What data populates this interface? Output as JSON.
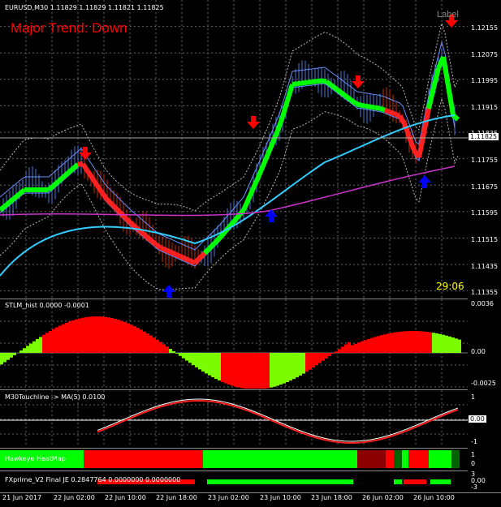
{
  "main": {
    "symbol_line": "EURUSD,M30  1.11829 1.11829 1.11821 1.11825",
    "trend_text": "Major Trend: Down",
    "corner_label": "Label",
    "timer": "29:06",
    "price_ticks": [
      "1.12155",
      "1.12075",
      "1.11995",
      "1.11915",
      "1.11835",
      "1.11755",
      "1.11675",
      "1.11595",
      "1.11515",
      "1.11435",
      "1.11355"
    ],
    "current_price": "1.11825",
    "colors": {
      "trend_text": "#ff0000",
      "timer": "#ffff00",
      "arrow_up": "#0000ff",
      "arrow_down": "#ff0000"
    }
  },
  "stlm": {
    "title": "STLM_hist 0.0000 -0.0001",
    "ticks": [
      "0.0036",
      "0.00",
      "-0.0025"
    ]
  },
  "touch": {
    "title": "M30Touchline -> MA(5) 0.0100",
    "ticks": [
      "1",
      "0",
      "-1"
    ],
    "value_box": "0.00"
  },
  "heatmap": {
    "title": "Hawkeye HeatMap",
    "ticks": [
      "1",
      "0"
    ]
  },
  "fxprime": {
    "title": "FXprime_V2 Final JE 0.2847764 0.0000000 0.0000000",
    "ticks": [
      "3",
      "0.00",
      "-3"
    ]
  },
  "time_axis": [
    "21 Jun 2017",
    "22 Jun 02:00",
    "22 Jun 10:00",
    "22 Jun 18:00",
    "23 Jun 02:00",
    "23 Jun 10:00",
    "23 Jun 18:00",
    "26 Jun 02:00",
    "26 Jun 10:00"
  ]
}
